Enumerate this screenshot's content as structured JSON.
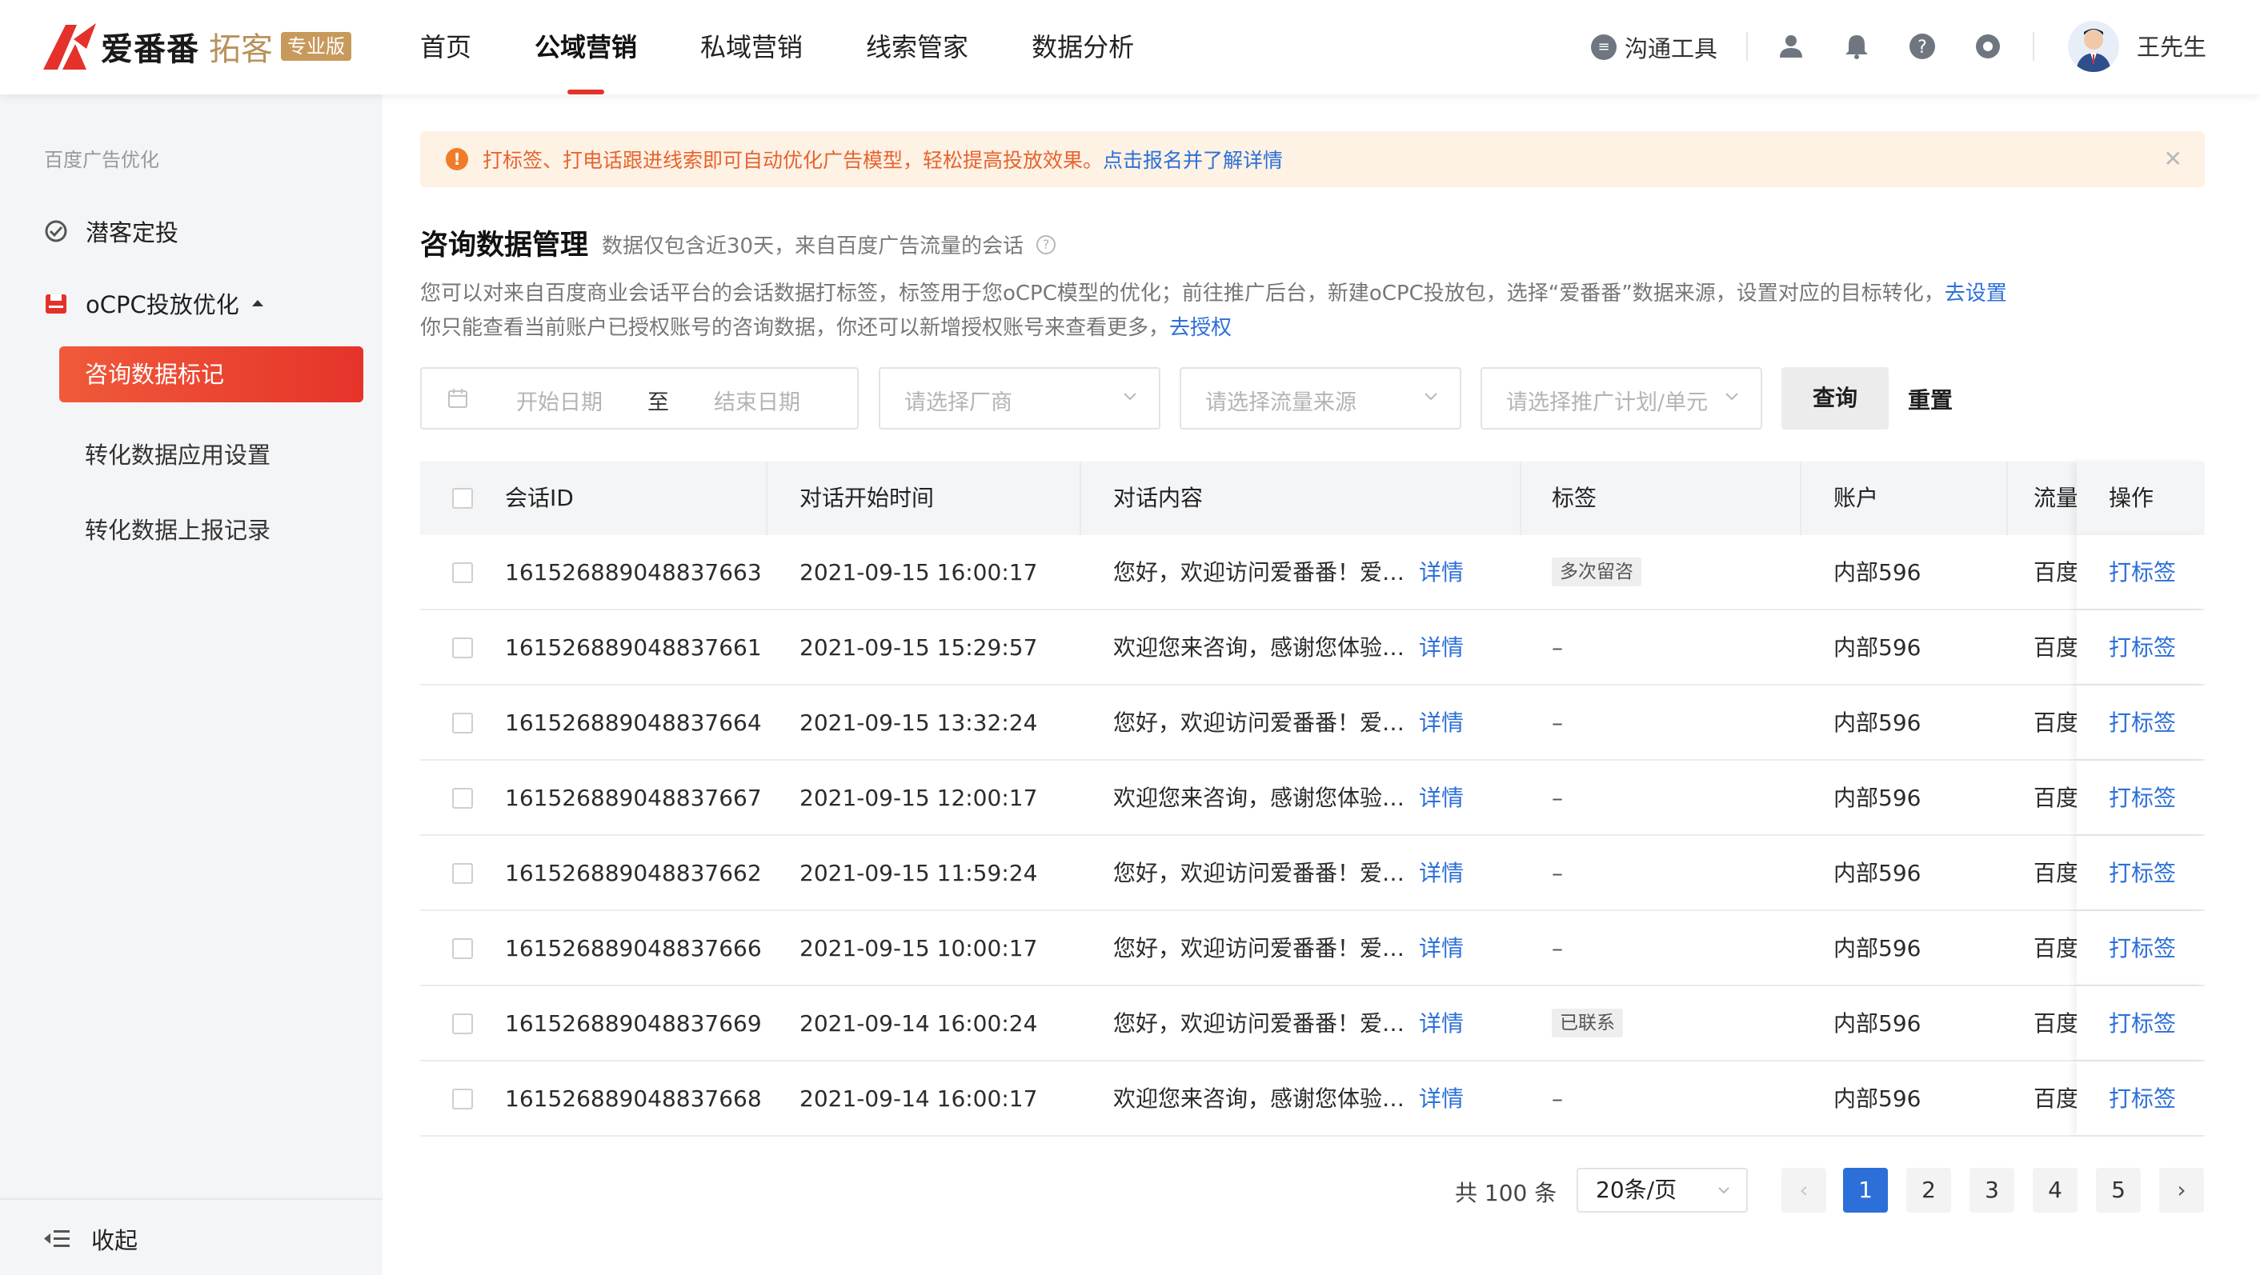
{
  "brand": {
    "name": "爱番番",
    "sub": "拓客",
    "badge": "专业版"
  },
  "nav": [
    "首页",
    "公域营销",
    "私域营销",
    "线索管家",
    "数据分析"
  ],
  "header": {
    "tool_label": "沟通工具",
    "user_name": "王先生"
  },
  "sidebar": {
    "section_title": "百度广告优化",
    "item_prospect": "潜客定投",
    "item_ocpc": "oCPC投放优化",
    "sub_items": [
      "咨询数据标记",
      "转化数据应用设置",
      "转化数据上报记录"
    ],
    "collapse_label": "收起"
  },
  "alert": {
    "text": "打标签、打电话跟进线索即可自动优化广告模型，轻松提高投放效果。",
    "link": "点击报名并了解详情"
  },
  "page": {
    "title": "咨询数据管理",
    "note": "数据仅包含近30天，来自百度广告流量的会话",
    "desc1": "您可以对来自百度商业会话平台的会话数据打标签，标签用于您oCPC模型的优化；前往推广后台，新建oCPC投放包，选择“爱番番”数据来源，设置对应的目标转化，",
    "desc1_link": "去设置",
    "desc2": "你只能查看当前账户已授权账号的咨询数据，你还可以新增授权账号来查看更多，",
    "desc2_link": "去授权"
  },
  "filters": {
    "start_date": "开始日期",
    "to": "至",
    "end_date": "结束日期",
    "vendor": "请选择厂商",
    "source": "请选择流量来源",
    "plan": "请选择推广计划/单元",
    "query": "查询",
    "reset": "重置"
  },
  "table": {
    "headers": [
      "会话ID",
      "对话开始时间",
      "对话内容",
      "标签",
      "账户",
      "流量",
      "操作"
    ],
    "detail_label": "详情",
    "action_label": "打标签",
    "rows": [
      {
        "id": "161526889048837663",
        "time": "2021-09-15 16:00:17",
        "content": "您好，欢迎访问爱番番！爱…",
        "tag": "多次留咨",
        "account": "内部596",
        "traffic": "百度"
      },
      {
        "id": "161526889048837661",
        "time": "2021-09-15 15:29:57",
        "content": "欢迎您来咨询，感谢您体验…",
        "tag": "",
        "account": "内部596",
        "traffic": "百度"
      },
      {
        "id": "161526889048837664",
        "time": "2021-09-15 13:32:24",
        "content": "您好，欢迎访问爱番番！爱…",
        "tag": "",
        "account": "内部596",
        "traffic": "百度"
      },
      {
        "id": "161526889048837667",
        "time": "2021-09-15 12:00:17",
        "content": "欢迎您来咨询，感谢您体验…",
        "tag": "",
        "account": "内部596",
        "traffic": "百度"
      },
      {
        "id": "161526889048837662",
        "time": "2021-09-15 11:59:24",
        "content": "您好，欢迎访问爱番番！爱…",
        "tag": "",
        "account": "内部596",
        "traffic": "百度"
      },
      {
        "id": "161526889048837666",
        "time": "2021-09-15 10:00:17",
        "content": "您好，欢迎访问爱番番！爱…",
        "tag": "",
        "account": "内部596",
        "traffic": "百度"
      },
      {
        "id": "161526889048837669",
        "time": "2021-09-14 16:00:24",
        "content": "您好，欢迎访问爱番番！爱…",
        "tag": "已联系",
        "account": "内部596",
        "traffic": "百度"
      },
      {
        "id": "161526889048837668",
        "time": "2021-09-14 16:00:17",
        "content": "欢迎您来咨询，感谢您体验…",
        "tag": "",
        "account": "内部596",
        "traffic": "百度"
      }
    ],
    "empty_tag": "–"
  },
  "pagination": {
    "total": "共 100 条",
    "page_size": "20条/页",
    "pages": [
      "1",
      "2",
      "3",
      "4",
      "5"
    ],
    "current": "1"
  },
  "colors": {
    "brand_red": "#e4312a",
    "link_blue": "#2c6fd8",
    "alert_orange": "#e8632f"
  }
}
